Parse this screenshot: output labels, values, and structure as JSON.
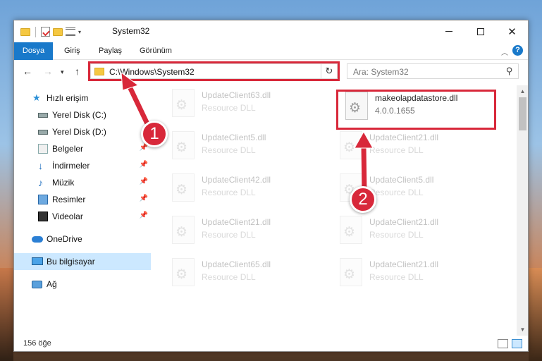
{
  "window": {
    "title": "System32",
    "controls": {
      "minimize": "minimize",
      "maximize": "maximize",
      "close": "✕"
    }
  },
  "ribbon": {
    "tabs": [
      "Dosya",
      "Giriş",
      "Paylaş",
      "Görünüm"
    ],
    "help_label": "?"
  },
  "nav": {
    "address": "C:\\Windows\\System32",
    "search_placeholder": "Ara: System32"
  },
  "sidebar": {
    "items": [
      {
        "label": "Hızlı erişim",
        "icon": "star-icon"
      },
      {
        "label": "Yerel Disk (C:)",
        "icon": "disk-icon"
      },
      {
        "label": "Yerel Disk (D:)",
        "icon": "disk-icon"
      },
      {
        "label": "Belgeler",
        "icon": "documents-icon",
        "pinned": true
      },
      {
        "label": "İndirmeler",
        "icon": "download-icon",
        "pinned": true
      },
      {
        "label": "Müzik",
        "icon": "music-icon",
        "pinned": true
      },
      {
        "label": "Resimler",
        "icon": "pictures-icon",
        "pinned": true
      },
      {
        "label": "Videolar",
        "icon": "videos-icon",
        "pinned": true
      },
      {
        "label": "OneDrive",
        "icon": "cloud-icon"
      },
      {
        "label": "Bu bilgisayar",
        "icon": "computer-icon",
        "selected": true
      },
      {
        "label": "Ağ",
        "icon": "network-icon"
      }
    ]
  },
  "files": {
    "highlight": {
      "name": "makeolapdatastore.dll",
      "version": "4.0.0.1655"
    },
    "faded": [
      {
        "name": "UpdateClient63.dll",
        "desc": "Resource DLL"
      },
      {
        "name": "UpdateClient5.dll",
        "desc": "Resource DLL"
      },
      {
        "name": "UpdateClient21.dll",
        "desc": "Resource DLL"
      },
      {
        "name": "UpdateClient42.dll",
        "desc": "Resource DLL"
      },
      {
        "name": "UpdateClient5.dll",
        "desc": "Resource DLL"
      },
      {
        "name": "UpdateClient21.dll",
        "desc": "Resource DLL"
      },
      {
        "name": "UpdateClient21.dll",
        "desc": "Resource DLL"
      },
      {
        "name": "UpdateClient65.dll",
        "desc": "Resource DLL"
      },
      {
        "name": "UpdateClient21.dll",
        "desc": "Resource DLL"
      }
    ]
  },
  "status": {
    "count": "156 öğe"
  },
  "annotations": {
    "step1": "1",
    "step2": "2",
    "color": "#d8283a"
  }
}
